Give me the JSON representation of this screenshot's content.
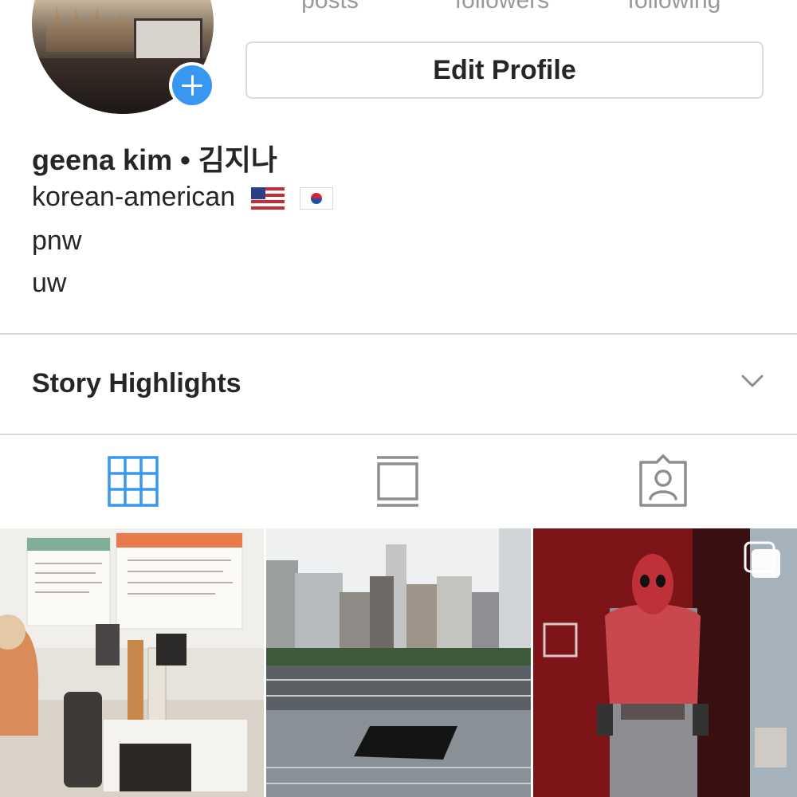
{
  "profile": {
    "stats": {
      "posts_label": "posts",
      "followers_label": "followers",
      "following_label": "following"
    },
    "edit_profile_label": "Edit Profile",
    "bio": {
      "name": "geena kim • 김지나",
      "line1": "korean-american",
      "line1_flags": [
        "us-flag",
        "korea-flag"
      ],
      "line2": "pnw",
      "line3": "uw"
    }
  },
  "highlights": {
    "title": "Story Highlights"
  },
  "tabs": [
    {
      "name": "grid",
      "icon": "grid-icon",
      "active": true
    },
    {
      "name": "feed",
      "icon": "feed-icon",
      "active": false
    },
    {
      "name": "tagged",
      "icon": "tagged-icon",
      "active": false
    }
  ],
  "grid": {
    "photos": [
      {
        "subject": "cafe-counter",
        "multi": false
      },
      {
        "subject": "memorial-pool-city",
        "multi": false
      },
      {
        "subject": "costume-exhibit",
        "multi": true
      }
    ]
  },
  "colors": {
    "accent": "#3897f0",
    "text": "#262626",
    "muted": "#999999",
    "divider": "#dbdbdb",
    "inactive_icon": "#8e8e8e"
  }
}
